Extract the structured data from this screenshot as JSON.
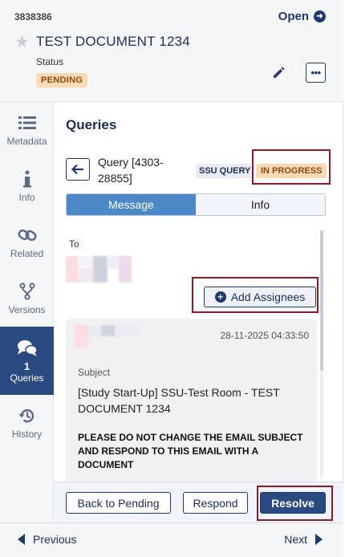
{
  "header": {
    "doc_id": "3838386",
    "open_label": "Open",
    "title": "TEST DOCUMENT 1234",
    "status_label": "Status",
    "status_value": "PENDING"
  },
  "sidebar": {
    "items": [
      {
        "label": "Metadata",
        "icon": "list-icon"
      },
      {
        "label": "Info",
        "icon": "info-icon"
      },
      {
        "label": "Related",
        "icon": "link-icon"
      },
      {
        "label": "Versions",
        "icon": "branch-icon"
      },
      {
        "label": "Queries",
        "icon": "chat-icon",
        "count": "1",
        "active": true
      },
      {
        "label": "History",
        "icon": "history-icon"
      }
    ]
  },
  "query": {
    "section_title": "Queries",
    "name": "Query [4303-28855]",
    "type_badge": "SSU QUERY",
    "status_badge": "IN PROGRESS",
    "tabs": [
      "Message",
      "Info"
    ],
    "to_label": "To",
    "add_assignees_label": "Add Assignees",
    "message": {
      "date": "28-11-2025 04:33:50",
      "subject_label": "Subject",
      "subject": "[Study Start-Up] SSU-Test Room - TEST DOCUMENT 1234",
      "body": "PLEASE DO NOT CHANGE THE EMAIL SUBJECT AND RESPOND TO THIS EMAIL WITH A DOCUMENT"
    }
  },
  "actions": {
    "back_to_pending": "Back to Pending",
    "respond": "Respond",
    "resolve": "Resolve"
  },
  "footer": {
    "previous": "Previous",
    "next": "Next"
  },
  "colors": {
    "primary": "#2a4a7f",
    "accent_blue": "#4c87c6",
    "badge_orange_bg": "#f7d9b5",
    "highlight_red": "#8a1c26"
  }
}
